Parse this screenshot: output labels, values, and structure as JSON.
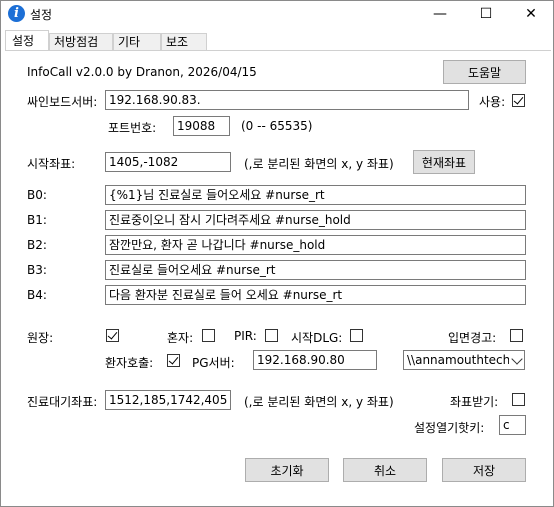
{
  "window": {
    "title": "설정"
  },
  "titlebar": {
    "minimize": "—",
    "maximize": "☐",
    "close": "✕"
  },
  "tabs": [
    {
      "label": "설정"
    },
    {
      "label": "처방점검"
    },
    {
      "label": "기타"
    },
    {
      "label": "보조"
    }
  ],
  "header": {
    "version": "InfoCall v2.0.0 by Dranon, 2026/04/15",
    "help_button": "도움말"
  },
  "server": {
    "label": "싸인보드서버:",
    "value": "192.168.90.83.",
    "use_label": "사용:",
    "use_checked": true,
    "port_label": "포트번호:",
    "port_value": "19088",
    "port_range": "(0 -- 65535)"
  },
  "start_coord": {
    "label": "시작좌표:",
    "value": "1405,-1082",
    "hint": "(,로 분리된 화면의 x, y 좌표)",
    "button": "현재좌표"
  },
  "messages": [
    {
      "label": "B0:",
      "value": "{%1}님 진료실로 들어오세요 #nurse_rt"
    },
    {
      "label": "B1:",
      "value": "진료중이오니 잠시 기다려주세요 #nurse_hold"
    },
    {
      "label": "B2:",
      "value": "잠깐만요, 환자 곧 나갑니다  #nurse_hold"
    },
    {
      "label": "B3:",
      "value": "진료실로 들어오세요 #nurse_rt"
    },
    {
      "label": "B4:",
      "value": "다음 환자분 진료실로 들어 오세요 #nurse_rt"
    }
  ],
  "options": {
    "director_label": "원장:",
    "director_checked": true,
    "alone_label": "혼자:",
    "alone_checked": false,
    "pir_label": "PIR:",
    "pir_checked": false,
    "startdlg_label": "시작DLG:",
    "startdlg_checked": false,
    "mouth_label": "입면경고:",
    "mouth_checked": false,
    "patient_call_label": "환자호출:",
    "patient_call_checked": true,
    "pg_label": "PG서버:",
    "pg_value": "192.168.90.80",
    "path_value": "\\\\annamouthtech"
  },
  "waiting": {
    "label": "진료대기좌표:",
    "value": "1512,185,1742,405",
    "hint": "(,로 분리된 화면의 x, y 좌표)",
    "receive_label": "좌표받기:",
    "receive_checked": false,
    "hotkey_label": "설정열기핫키:",
    "hotkey_value": "c"
  },
  "footer": {
    "reset": "초기화",
    "cancel": "취소",
    "save": "저장"
  }
}
